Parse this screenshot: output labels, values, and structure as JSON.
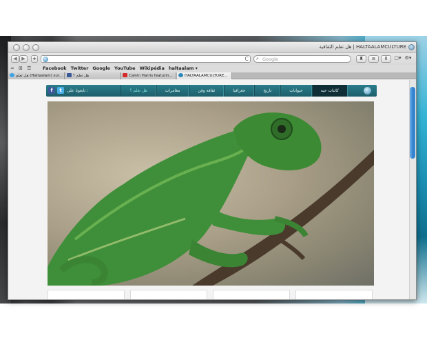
{
  "window": {
    "title": "HALTAALAMCULTURE | هل تعلم الثقافية"
  },
  "navigation": {
    "back_label": "◀",
    "forward_label": "▶",
    "new_tab_label": "+",
    "url": "",
    "reload_label": "C",
    "search_placeholder": "Google"
  },
  "bookmarks": {
    "items": [
      "Facebook",
      "Twitter",
      "Google",
      "YouTube",
      "Wikipédia",
      "haltaalam ▾"
    ]
  },
  "tabs": [
    {
      "label": "هل تعلم (Haltaalam) sur...",
      "icon": "twitter-icon"
    },
    {
      "label": "هل تعلم ؟",
      "icon": "facebook-icon"
    },
    {
      "label": "Calvin Harris featurin...",
      "icon": "youtube-icon"
    },
    {
      "label": "HALTAALAMCULTURE...",
      "icon": "globe-icon",
      "active": true
    }
  ],
  "site_menu": {
    "items": [
      "كائنات حية",
      "حيوانات",
      "تاريخ",
      "جغرافيا",
      "ثقافة وفن",
      "مغامرات",
      "هل تعلم ؟"
    ],
    "active_index": 0,
    "highlight_index": 6,
    "social_label": "تابعونا على :"
  },
  "hero": {
    "subject": "chameleon-photo"
  },
  "colors": {
    "nav_bar": "#1f5e6b",
    "scroll_thumb": "#2f7fcf"
  }
}
